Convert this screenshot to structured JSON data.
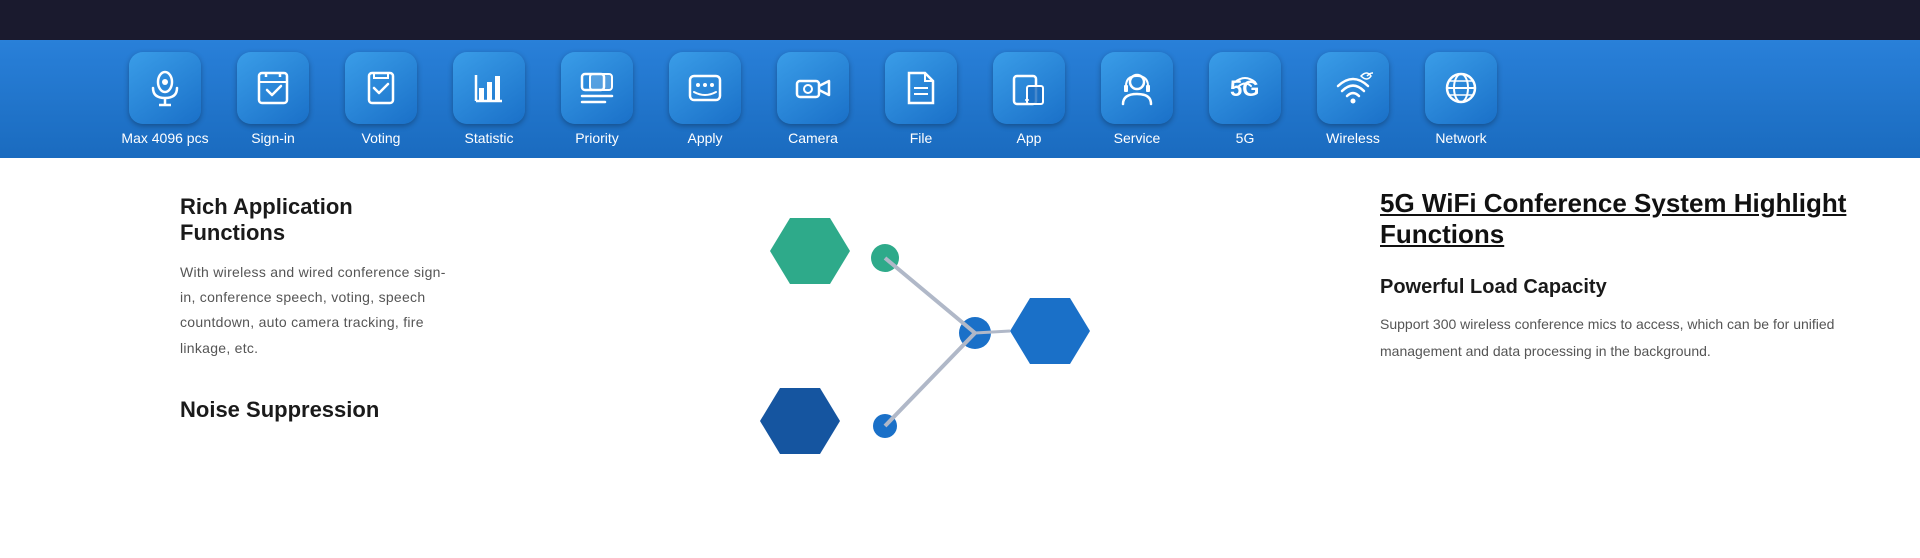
{
  "topBar": {
    "background": "#1a1a2e"
  },
  "toolbar": {
    "items": [
      {
        "id": "max4096",
        "label": "Max 4096 pcs",
        "icon": "mic"
      },
      {
        "id": "signin",
        "label": "Sign-in",
        "icon": "signin"
      },
      {
        "id": "voting",
        "label": "Voting",
        "icon": "voting"
      },
      {
        "id": "statistic",
        "label": "Statistic",
        "icon": "statistic"
      },
      {
        "id": "priority",
        "label": "Priority",
        "icon": "priority"
      },
      {
        "id": "apply",
        "label": "Apply",
        "icon": "apply"
      },
      {
        "id": "camera",
        "label": "Camera",
        "icon": "camera"
      },
      {
        "id": "file",
        "label": "File",
        "icon": "file"
      },
      {
        "id": "app",
        "label": "App",
        "icon": "app"
      },
      {
        "id": "service",
        "label": "Service",
        "icon": "service"
      },
      {
        "id": "fiveg",
        "label": "5G",
        "icon": "fiveg"
      },
      {
        "id": "wireless",
        "label": "Wireless",
        "icon": "wireless"
      },
      {
        "id": "network",
        "label": "Network",
        "icon": "network"
      }
    ]
  },
  "leftSection": {
    "richTitle": "Rich Application Functions",
    "richText": "With wireless and wired conference sign-in, conference speech, voting, speech countdown, auto camera tracking, fire linkage, etc.",
    "noiseTitle": "Noise Suppression"
  },
  "rightSection": {
    "highlightTitle": "5G WiFi Conference System  Highlight Functions",
    "featureTitle": "Powerful Load Capacity",
    "featureText": "Support 300 wireless conference mics to access, which can be  for unified management and data processing in the background."
  }
}
